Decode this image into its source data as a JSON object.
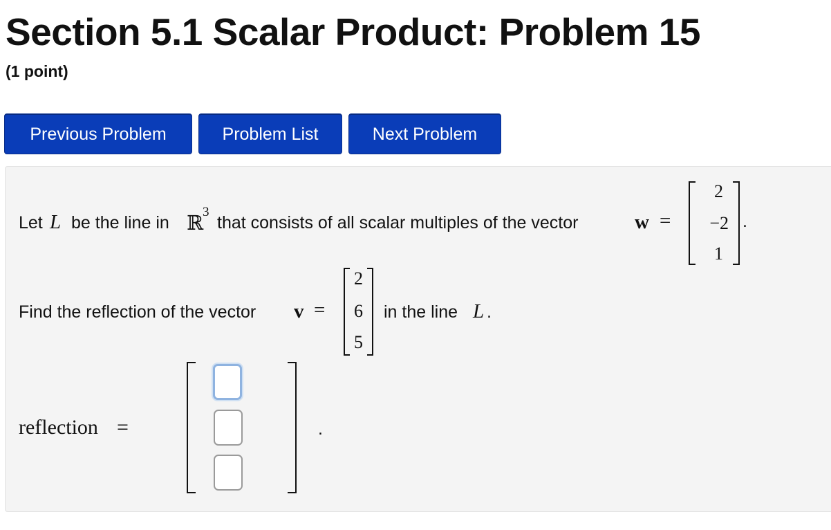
{
  "header": {
    "title": "Section 5.1 Scalar Product: Problem 15",
    "points": "(1 point)"
  },
  "nav": {
    "previous_label": "Previous Problem",
    "list_label": "Problem List",
    "next_label": "Next Problem"
  },
  "problem": {
    "line1": {
      "text_a": "Let",
      "var_L": "L",
      "text_b": "be the line in",
      "space": "ℝ",
      "exponent": "3",
      "text_c": "that consists of all scalar multiples of the vector",
      "var_w": "w",
      "equals": "=",
      "period": "."
    },
    "w_vector": [
      "2",
      "−2",
      "1"
    ],
    "line2": {
      "text_a": "Find the reflection of the vector",
      "var_v": "v",
      "equals": "=",
      "text_b": "in the line",
      "var_L": "L",
      "period": "."
    },
    "v_vector": [
      "2",
      "6",
      "5"
    ],
    "answer": {
      "label": "reflection",
      "equals": "=",
      "inputs": [
        "",
        "",
        ""
      ],
      "period": "."
    }
  }
}
